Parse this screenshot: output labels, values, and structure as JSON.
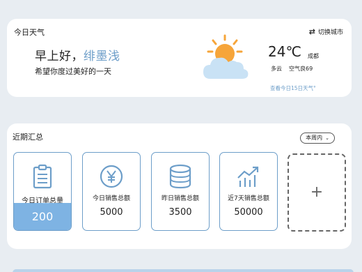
{
  "weather": {
    "title": "今日天气",
    "switch_city_label": "切换城市",
    "greeting_prefix": "早上好，",
    "user_name": "绯墨浅",
    "wish": "希望你度过美好的一天",
    "temperature": "24℃",
    "city": "成都",
    "condition": "多云",
    "air_quality": "空气良69",
    "forecast_link": "查看今日15日天气°",
    "icon": "partly-cloudy-icon"
  },
  "summary": {
    "title": "近期汇总",
    "period_selected": "本周内",
    "tiles": [
      {
        "label": "今日订单总量",
        "value": "200",
        "icon": "clipboard-icon"
      },
      {
        "label": "今日销售总额",
        "value": "5000",
        "icon": "yen-coin-icon"
      },
      {
        "label": "昨日销售总额",
        "value": "3500",
        "icon": "coin-stack-icon"
      },
      {
        "label": "近7天销售总额",
        "value": "50000",
        "icon": "growth-chart-icon"
      }
    ],
    "add_label": "+"
  },
  "colors": {
    "accent": "#6d9ec9",
    "tile_highlight": "#7eb3e3",
    "background": "#e8edf2"
  }
}
